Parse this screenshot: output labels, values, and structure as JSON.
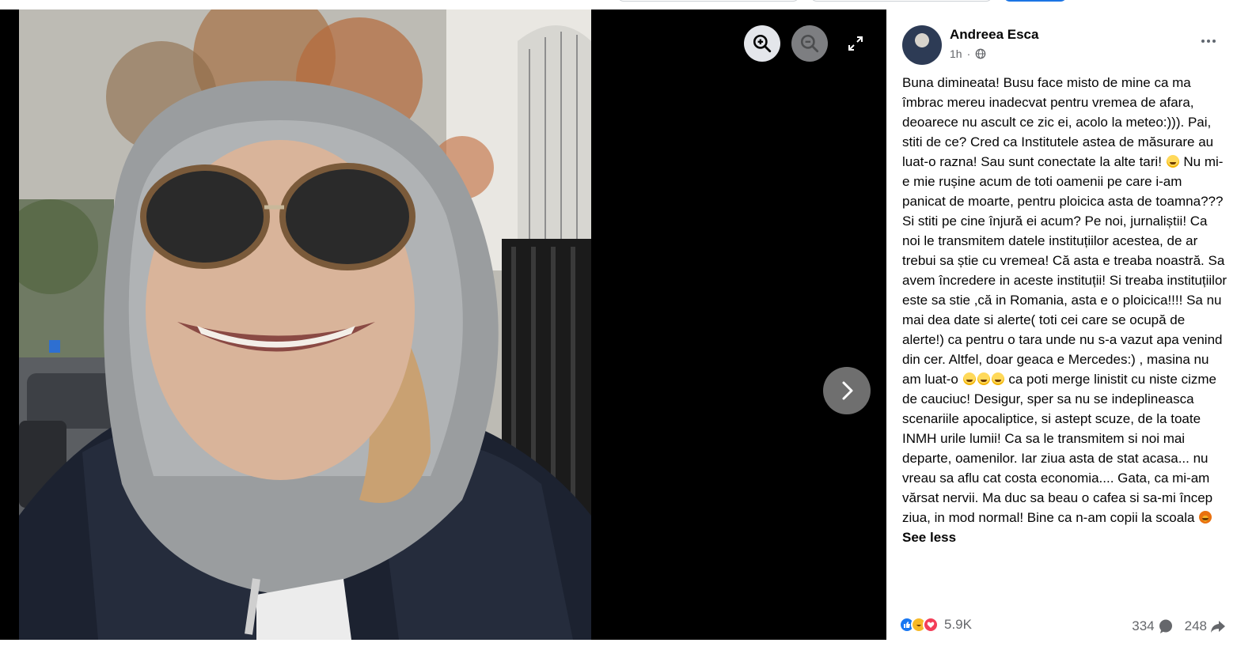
{
  "viewer": {
    "zoom_in_icon": "zoom-in-icon",
    "zoom_out_icon": "zoom-out-icon",
    "fullscreen_icon": "expand-icon",
    "next_icon": "chevron-right-icon"
  },
  "post": {
    "author": "Andreea Esca",
    "time": "1h",
    "audience_icon": "globe-icon",
    "text_before_emoji_1": "Buna dimineata! Busu face misto de mine ca ma îmbrac mereu inadecvat pentru vremea de afara, deoarece nu ascult ce zic ei, acolo la meteo:))). Pai, stiti de ce? Cred ca Institutele astea de măsurare au luat-o razna! Sau sunt conectate la alte tari!",
    "text_after_emoji_1": "Nu mi-e mie rușine acum de toti oamenii pe care i-am panicat de moarte, pentru ploicica asta de toamna??? Si stiti pe cine înjură ei acum? Pe noi, jurnaliștii! Ca noi le transmitem datele instituțiilor acestea, de ar trebui sa știe cu vremea! Că asta e treaba noastră. Sa avem încredere in aceste instituții! Si treaba instituțiilor este sa stie ,că in Romania, asta e o ploicica!!!! Sa nu mai dea date si alerte( toti cei care se ocupă de alerte!) ca pentru o tara unde nu s-a vazut apa venind din cer. Altfel, doar geaca e Mercedes:) , masina nu am luat-o",
    "text_after_emoji_group": "ca poti merge linistit cu niste cizme de cauciuc! Desigur, sper sa nu se indeplineasca scenariile apocaliptice, si astept scuze, de la toate INMH urile lumii! Ca sa le transmitem si noi mai departe, oamenilor. Iar ziua asta de stat acasa... nu vreau sa aflu cat costa economia.... Gata, ca mi-am vărsat nervii. Ma duc sa beau o cafea si sa-mi încep ziua, in mod normal! Bine ca n-am copii la scoala",
    "see_less": "See less"
  },
  "footer": {
    "reaction_count": "5.9K",
    "comments": "334",
    "shares": "248"
  },
  "colors": {
    "accent": "#1877f2",
    "secondary_text": "#65676b",
    "viewer_bg": "#000000"
  }
}
